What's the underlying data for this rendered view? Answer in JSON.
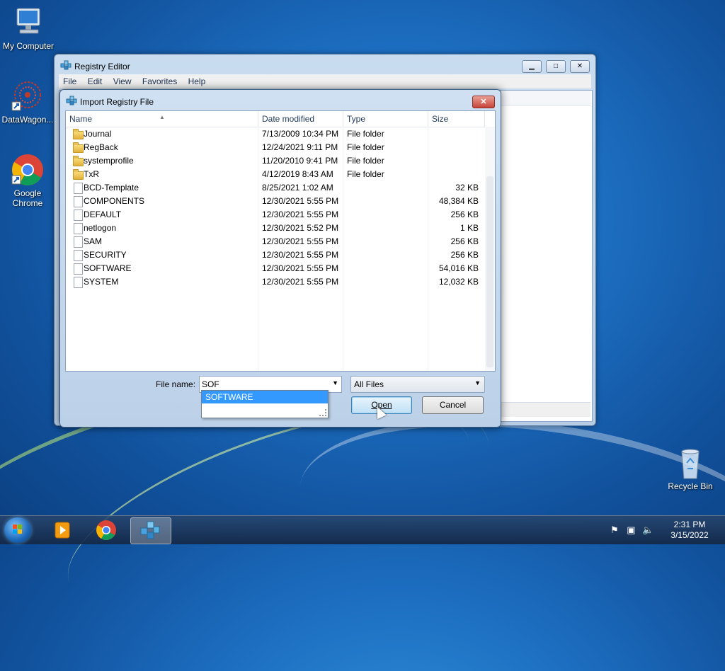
{
  "desktop": {
    "icons": [
      {
        "label": "My Computer"
      },
      {
        "label": "DataWagon..."
      },
      {
        "label": "Google Chrome"
      },
      {
        "label": "Recycle Bin"
      }
    ]
  },
  "registry_editor": {
    "title": "Registry Editor",
    "menu": [
      "File",
      "Edit",
      "View",
      "Favorites",
      "Help"
    ]
  },
  "dialog": {
    "title": "Import Registry File",
    "columns": {
      "name": "Name",
      "date": "Date modified",
      "type": "Type",
      "size": "Size"
    },
    "files": [
      {
        "name": "Journal",
        "date": "7/13/2009 10:34 PM",
        "type": "File folder",
        "size": "",
        "icon": "folder-icon"
      },
      {
        "name": "RegBack",
        "date": "12/24/2021 9:11 PM",
        "type": "File folder",
        "size": "",
        "icon": "folder-icon"
      },
      {
        "name": "systemprofile",
        "date": "11/20/2010 9:41 PM",
        "type": "File folder",
        "size": "",
        "icon": "folder-icon"
      },
      {
        "name": "TxR",
        "date": "4/12/2019 8:43 AM",
        "type": "File folder",
        "size": "",
        "icon": "folder-icon"
      },
      {
        "name": "BCD-Template",
        "date": "8/25/2021 1:02 AM",
        "type": "",
        "size": "32 KB",
        "icon": "file-icon"
      },
      {
        "name": "COMPONENTS",
        "date": "12/30/2021 5:55 PM",
        "type": "",
        "size": "48,384 KB",
        "icon": "file-icon"
      },
      {
        "name": "DEFAULT",
        "date": "12/30/2021 5:55 PM",
        "type": "",
        "size": "256 KB",
        "icon": "file-icon"
      },
      {
        "name": "netlogon",
        "date": "12/30/2021 5:52 PM",
        "type": "",
        "size": "1 KB",
        "icon": "file-icon"
      },
      {
        "name": "SAM",
        "date": "12/30/2021 5:55 PM",
        "type": "",
        "size": "256 KB",
        "icon": "file-icon"
      },
      {
        "name": "SECURITY",
        "date": "12/30/2021 5:55 PM",
        "type": "",
        "size": "256 KB",
        "icon": "file-icon"
      },
      {
        "name": "SOFTWARE",
        "date": "12/30/2021 5:55 PM",
        "type": "",
        "size": "54,016 KB",
        "icon": "file-icon"
      },
      {
        "name": "SYSTEM",
        "date": "12/30/2021 5:55 PM",
        "type": "",
        "size": "12,032 KB",
        "icon": "file-icon"
      }
    ],
    "file_name_label": "File name:",
    "file_name_value": "SOF",
    "autocomplete_suggestion": "SOFTWARE",
    "file_type_value": "All Files",
    "open_label": "Open",
    "cancel_label": "Cancel"
  },
  "taskbar": {
    "time": "2:31 PM",
    "date": "3/15/2022"
  }
}
